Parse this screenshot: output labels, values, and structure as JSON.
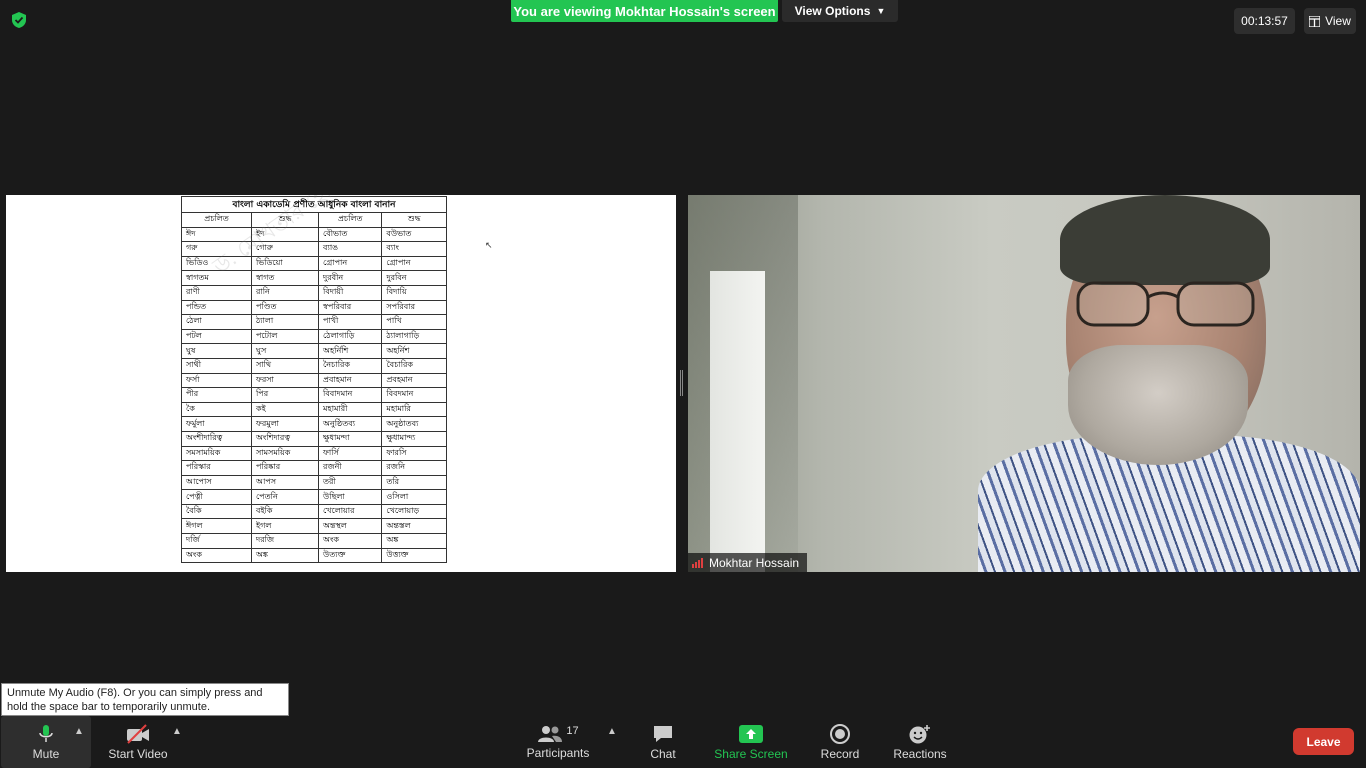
{
  "app": {
    "viewing_banner": "You are viewing Mokhtar Hossain's screen",
    "view_options_label": "View Options",
    "timer": "00:13:57",
    "view_label": "View"
  },
  "document": {
    "title": "বাংলা একাডেমি প্রণীত আধুনিক বাংলা বানান",
    "headers": [
      "প্রচলিত",
      "শুদ্ধ",
      "প্রচলিত",
      "শুদ্ধ"
    ],
    "rows": [
      [
        "ঈদ",
        "ইদ",
        "বৌভাত",
        "বউভাত"
      ],
      [
        "গরু",
        "গোরু",
        "ব্যাঙ",
        "ব্যাং"
      ],
      [
        "ভিডিও",
        "ভিডিয়ো",
        "গ্রোপান",
        "গ্রোপান"
      ],
      [
        "স্বাগতম",
        "স্বাগত",
        "দুরবীন",
        "দুরবিন"
      ],
      [
        "রাণী",
        "রানি",
        "বিদায়ী",
        "বিদায়ি"
      ],
      [
        "পন্ডিত",
        "পণ্ডিত",
        "স্বপরিবার",
        "সপরিবার"
      ],
      [
        "ঠেলা",
        "ঠ্যালা",
        "পাখী",
        "পাখি"
      ],
      [
        "পটল",
        "পটোল",
        "ঠেলাগাড়ি",
        "ঠ্যালাগাড়ি"
      ],
      [
        "ঘুষ",
        "ঘুস",
        "অহর্নিশি",
        "অহর্নিশ"
      ],
      [
        "সাথী",
        "সাথি",
        "নৈচারিক",
        "বৈচারিক"
      ],
      [
        "ফর্সা",
        "ফরসা",
        "প্রবাহমান",
        "প্রবহমান"
      ],
      [
        "পীর",
        "পির",
        "বিবাদমান",
        "বিবদমান"
      ],
      [
        "কৈ",
        "কই",
        "মহামারী",
        "মহামারি"
      ],
      [
        "ফর্মুলা",
        "ফরমুলা",
        "অনুষ্ঠিতব্য",
        "অনুষ্ঠাতব্য"
      ],
      [
        "অংশীদারিত্ব",
        "অংশিদারত্ব",
        "ক্ষুধামন্দা",
        "ক্ষুধামান্দ্য"
      ],
      [
        "সমসাময়িক",
        "সামসময়িক",
        "ফার্সি",
        "ফারসি"
      ],
      [
        "পরিস্কার",
        "পরিষ্কার",
        "রজনী",
        "রজনি"
      ],
      [
        "আপোস",
        "আপস",
        "তরী",
        "তরি"
      ],
      [
        "পেত্নী",
        "পেতনি",
        "উছিলা",
        "ওসিলা"
      ],
      [
        "বৈকি",
        "বইকি",
        "খেলোয়ার",
        "খেলোয়াড়"
      ],
      [
        "ঈগল",
        "ইগল",
        "অন্তস্থল",
        "অন্তস্তল"
      ],
      [
        "দর্জি",
        "দরজি",
        "অংক",
        "অঙ্ক"
      ],
      [
        "অংক",
        "অঙ্ক",
        "উত্যক্ত",
        "উত্ত্যক্ত"
      ]
    ]
  },
  "video": {
    "participant_name": "Mokhtar Hossain"
  },
  "tooltip": {
    "text": "Unmute My Audio (F8). Or you can simply press and hold the space bar to temporarily unmute."
  },
  "toolbar": {
    "mute_label": "Mute",
    "start_video_label": "Start Video",
    "participants_label": "Participants",
    "participants_count": "17",
    "chat_label": "Chat",
    "share_screen_label": "Share Screen",
    "record_label": "Record",
    "reactions_label": "Reactions",
    "leave_label": "Leave"
  },
  "colors": {
    "accent_green": "#23c552",
    "leave_red": "#d13a2f",
    "background": "#1a1a1a"
  }
}
